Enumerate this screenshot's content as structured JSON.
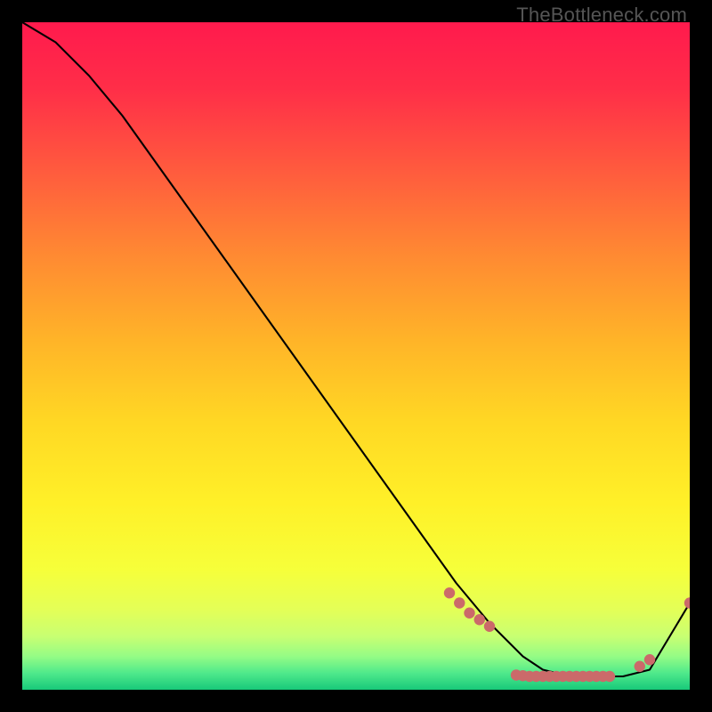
{
  "watermark": "TheBottleneck.com",
  "chart_data": {
    "type": "line",
    "title": "",
    "xlabel": "",
    "ylabel": "",
    "xlim": [
      0,
      100
    ],
    "ylim": [
      0,
      100
    ],
    "grid": false,
    "background": "rainbow-gradient red→orange→yellow→green vertical",
    "series": [
      {
        "name": "curve",
        "color": "#000000",
        "x": [
          0,
          5,
          10,
          15,
          20,
          25,
          30,
          35,
          40,
          45,
          50,
          55,
          60,
          65,
          70,
          75,
          78,
          82,
          86,
          90,
          94,
          100
        ],
        "y": [
          100,
          97,
          92,
          86,
          79,
          72,
          65,
          58,
          51,
          44,
          37,
          30,
          23,
          16,
          10,
          5,
          3,
          2,
          2,
          2,
          3,
          13
        ]
      }
    ],
    "points": {
      "name": "dots",
      "color": "#cb6a6a",
      "x": [
        64,
        65.5,
        67,
        68.5,
        70,
        74,
        75,
        76,
        77,
        78,
        79,
        80,
        81,
        82,
        83,
        84,
        85,
        86,
        87,
        88,
        92.5,
        94,
        100
      ],
      "y": [
        14.5,
        13,
        11.5,
        10.5,
        9.5,
        2.2,
        2.1,
        2.0,
        2.0,
        2.0,
        2.0,
        2.0,
        2.0,
        2.0,
        2.0,
        2.0,
        2.0,
        2.0,
        2.0,
        2.0,
        3.5,
        4.5,
        13
      ]
    }
  }
}
